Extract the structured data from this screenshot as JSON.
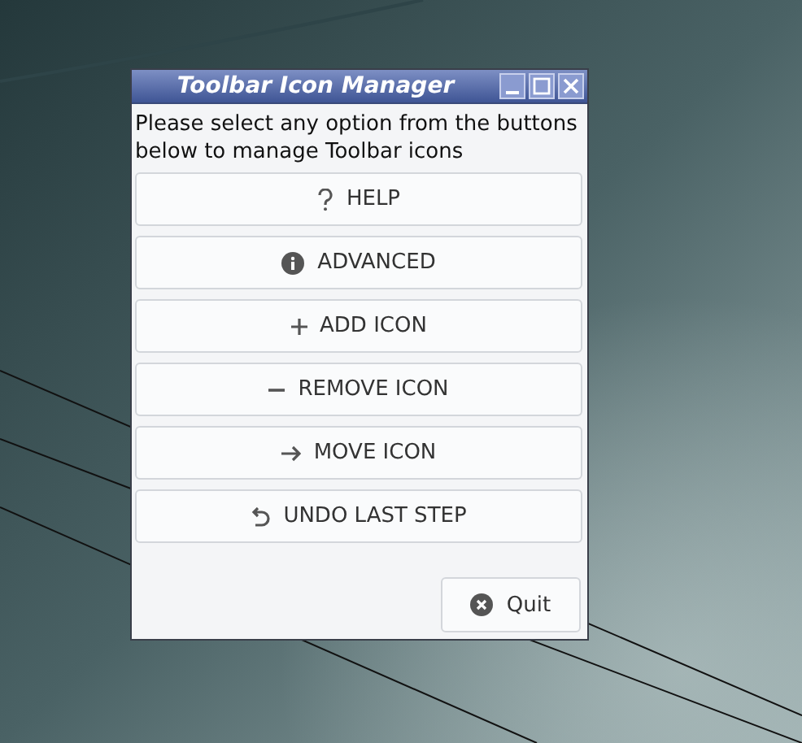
{
  "window": {
    "title": "Toolbar Icon Manager"
  },
  "message": "Please select any option from the buttons below to manage Toolbar icons",
  "buttons": [
    {
      "kind": "help",
      "label": "HELP"
    },
    {
      "kind": "info",
      "label": "ADVANCED"
    },
    {
      "kind": "add",
      "label": "ADD ICON"
    },
    {
      "kind": "remove",
      "label": "REMOVE ICON"
    },
    {
      "kind": "move",
      "label": "MOVE ICON"
    },
    {
      "kind": "undo",
      "label": "UNDO LAST STEP"
    }
  ],
  "quit_button": {
    "label": "Quit"
  }
}
